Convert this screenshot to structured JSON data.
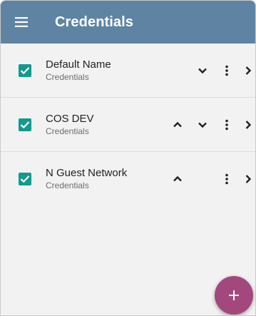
{
  "appbar": {
    "title": "Credentials",
    "menu_icon": "hamburger-menu-icon",
    "color": "#5f84a3"
  },
  "credentials": [
    {
      "name": "Default Name",
      "subtitle": "Credentials",
      "checked": true,
      "show_up": false,
      "show_down": true
    },
    {
      "name": "COS DEV",
      "subtitle": "Credentials",
      "checked": true,
      "show_up": true,
      "show_down": true
    },
    {
      "name": "N Guest Network",
      "subtitle": "Credentials",
      "checked": true,
      "show_up": true,
      "show_down": false
    }
  ],
  "row_icons": {
    "checkbox": "checkbox-checked-icon",
    "move_up": "chevron-up-icon",
    "move_down": "chevron-down-icon",
    "more": "more-vertical-icon",
    "open": "chevron-right-icon"
  },
  "fab": {
    "icon": "plus-icon",
    "color": "#a2487d"
  },
  "colors": {
    "checkbox": "#129a8f",
    "background": "#f2f2f2"
  }
}
